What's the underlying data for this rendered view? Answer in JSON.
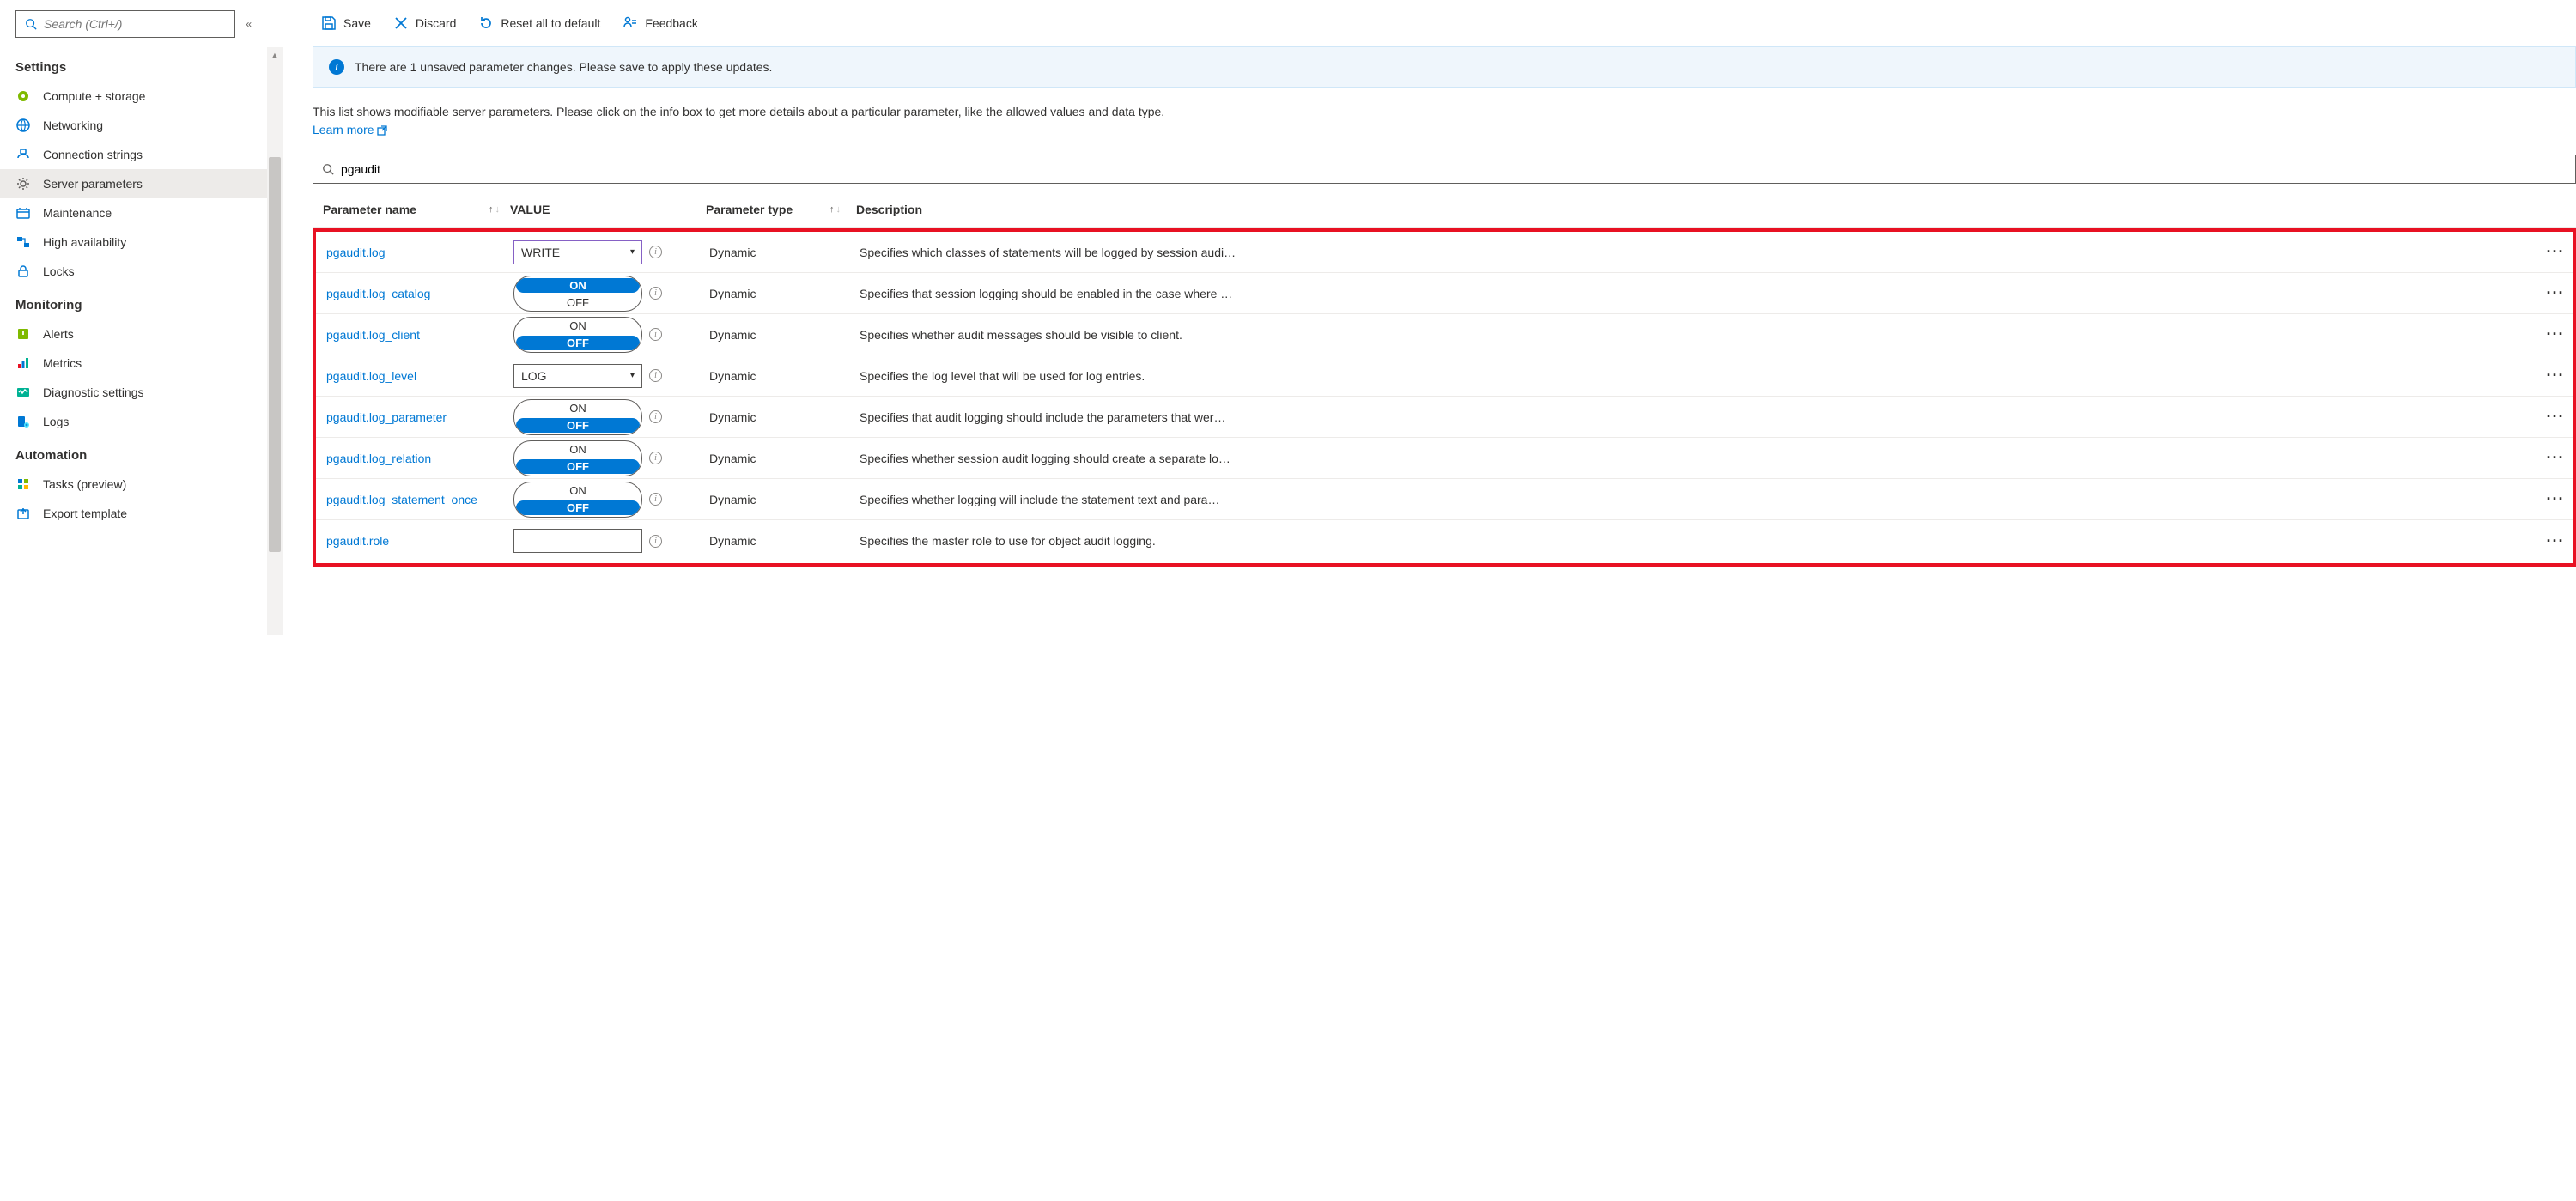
{
  "sidebar": {
    "search_placeholder": "Search (Ctrl+/)",
    "groups": [
      {
        "title": "Settings",
        "items": [
          {
            "label": "Compute + storage",
            "icon": "compute-icon",
            "selected": false
          },
          {
            "label": "Networking",
            "icon": "globe-icon",
            "selected": false
          },
          {
            "label": "Connection strings",
            "icon": "connection-icon",
            "selected": false
          },
          {
            "label": "Server parameters",
            "icon": "gear-icon",
            "selected": true
          },
          {
            "label": "Maintenance",
            "icon": "maintenance-icon",
            "selected": false
          },
          {
            "label": "High availability",
            "icon": "ha-icon",
            "selected": false
          },
          {
            "label": "Locks",
            "icon": "lock-icon",
            "selected": false
          }
        ]
      },
      {
        "title": "Monitoring",
        "items": [
          {
            "label": "Alerts",
            "icon": "alert-icon",
            "selected": false
          },
          {
            "label": "Metrics",
            "icon": "metrics-icon",
            "selected": false
          },
          {
            "label": "Diagnostic settings",
            "icon": "diagnostic-icon",
            "selected": false
          },
          {
            "label": "Logs",
            "icon": "logs-icon",
            "selected": false
          }
        ]
      },
      {
        "title": "Automation",
        "items": [
          {
            "label": "Tasks (preview)",
            "icon": "tasks-icon",
            "selected": false
          },
          {
            "label": "Export template",
            "icon": "export-icon",
            "selected": false
          }
        ]
      }
    ]
  },
  "toolbar": {
    "save": "Save",
    "discard": "Discard",
    "reset": "Reset all to default",
    "feedback": "Feedback"
  },
  "infobar": "There are 1 unsaved parameter changes.  Please save to apply these updates.",
  "description": "This list shows modifiable server parameters. Please click on the info box to get more details about a particular parameter, like the allowed values and data type.",
  "learn_more": "Learn more",
  "filter_value": "pgaudit",
  "columns": {
    "name": "Parameter name",
    "value": "VALUE",
    "type": "Parameter type",
    "desc": "Description"
  },
  "toggle_labels": {
    "on": "ON",
    "off": "OFF"
  },
  "rows": [
    {
      "name": "pgaudit.log",
      "control": "select",
      "value": "WRITE",
      "changed": true,
      "type": "Dynamic",
      "desc": "Specifies which classes of statements will be logged by session audi…"
    },
    {
      "name": "pgaudit.log_catalog",
      "control": "toggle",
      "value": "ON",
      "type": "Dynamic",
      "desc": "Specifies that session logging should be enabled in the case where …"
    },
    {
      "name": "pgaudit.log_client",
      "control": "toggle",
      "value": "OFF",
      "type": "Dynamic",
      "desc": "Specifies whether audit messages should be visible to client."
    },
    {
      "name": "pgaudit.log_level",
      "control": "select",
      "value": "LOG",
      "changed": false,
      "type": "Dynamic",
      "desc": "Specifies the log level that will be used for log entries."
    },
    {
      "name": "pgaudit.log_parameter",
      "control": "toggle",
      "value": "OFF",
      "type": "Dynamic",
      "desc": "Specifies that audit logging should include the parameters that wer…"
    },
    {
      "name": "pgaudit.log_relation",
      "control": "toggle",
      "value": "OFF",
      "type": "Dynamic",
      "desc": "Specifies whether session audit logging should create a separate lo…"
    },
    {
      "name": "pgaudit.log_statement_once",
      "control": "toggle",
      "value": "OFF",
      "type": "Dynamic",
      "desc": "Specifies whether logging will include the statement text and para…"
    },
    {
      "name": "pgaudit.role",
      "control": "text",
      "value": "",
      "type": "Dynamic",
      "desc": "Specifies the master role to use for object audit logging."
    }
  ]
}
